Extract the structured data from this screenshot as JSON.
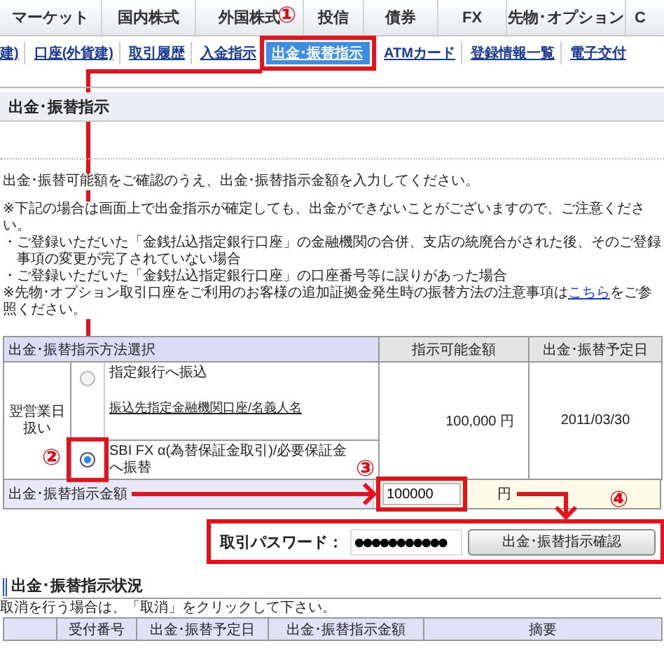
{
  "top_nav": {
    "items": [
      {
        "label": "マーケット"
      },
      {
        "label": "国内株式"
      },
      {
        "label": "外国株式"
      },
      {
        "label": "投信"
      },
      {
        "label": "債券"
      },
      {
        "label": "FX"
      },
      {
        "label": "先物･オプション"
      },
      {
        "label": "C"
      }
    ]
  },
  "sub_nav": {
    "items": [
      {
        "label": "建)",
        "selected": false
      },
      {
        "label": "口座(外貨建)",
        "selected": false
      },
      {
        "label": "取引履歴",
        "selected": false
      },
      {
        "label": "入金指示",
        "selected": false
      },
      {
        "label": "出金･振替指示",
        "selected": true
      },
      {
        "label": "ATMカード",
        "selected": false
      },
      {
        "label": "登録情報一覧",
        "selected": false
      },
      {
        "label": "電子交付",
        "selected": false
      }
    ]
  },
  "page_title": "出金･振替指示",
  "intro": "出金･振替可能額をご確認のうえ、出金･振替指示金額を入力してください。",
  "notes": [
    {
      "kind": "note",
      "text": "※下記の場合は画面上で出金指示が確定しても、出金ができないことがございますので、ご注意ください。"
    },
    {
      "kind": "bullet",
      "text": "・ご登録いただいた「金銭払込指定銀行口座」の金融機関の合併、支店の統廃合がされた後、そのご登録事項の変更が完了されていない場合"
    },
    {
      "kind": "bullet",
      "text": "・ご登録いただいた「金銭払込指定銀行口座」の口座番号等に誤りがあった場合"
    },
    {
      "kind": "link_note",
      "text": "※先物･オプション取引口座をご利用のお客様の追加証拠金発生時の振替方法の注意事項は",
      "link": "こちら",
      "after": "をご参照ください。"
    }
  ],
  "method_table": {
    "columns": [
      "出金･振替指示方法選択",
      "指示可能金額",
      "出金･振替予定日"
    ],
    "timing": "翌営業日扱い",
    "options": [
      {
        "label": "指定銀行へ振込",
        "link": "振込先指定金融機関口座/名義人名",
        "selected": false
      },
      {
        "label": "SBI FX α(為替保証金取引)/必要保証金へ振替",
        "selected": true
      }
    ],
    "available_amount": "100,000 円",
    "scheduled_date": "2011/03/30"
  },
  "amount": {
    "label": "出金･振替指示金額",
    "value": "100000",
    "unit": "円"
  },
  "password": {
    "label": "取引パスワード：",
    "value": "●●●●●●●●●●●",
    "button": "出金･振替指示確認"
  },
  "status": {
    "title": "出金･振替指示状況",
    "hint": "取消を行う場合は、「取消」をクリックして下さい。",
    "columns": [
      "受付番号",
      "出金･振替予定日",
      "出金･振替指示金額",
      "摘要"
    ]
  },
  "annotations": [
    {
      "label": "①"
    },
    {
      "label": "②"
    },
    {
      "label": "③"
    },
    {
      "label": "④"
    }
  ]
}
